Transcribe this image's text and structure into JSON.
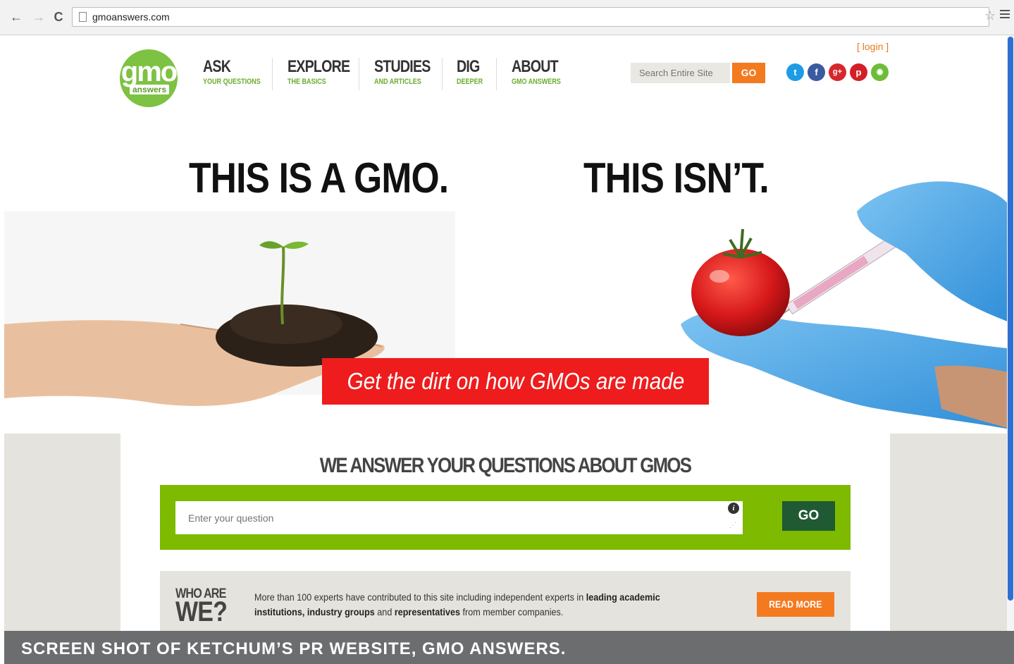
{
  "browser": {
    "url": "gmoanswers.com",
    "back_icon": "←",
    "forward_icon": "→",
    "reload_icon": "C",
    "star_icon": "☆"
  },
  "header": {
    "logo_top": "gmo",
    "logo_bottom": "answers",
    "login": "[ login ]",
    "search_placeholder": "Search Entire Site",
    "search_go": "GO",
    "nav": [
      {
        "big": "ASK",
        "small": "YOUR QUESTIONS"
      },
      {
        "big": "EXPLORE",
        "small": "THE BASICS"
      },
      {
        "big": "STUDIES",
        "small": "AND ARTICLES"
      },
      {
        "big": "DIG",
        "small": "DEEPER"
      },
      {
        "big": "ABOUT",
        "small": "GMO ANSWERS"
      }
    ],
    "social": [
      {
        "name": "twitter-icon",
        "glyph": "t",
        "color": "#1e9be6"
      },
      {
        "name": "facebook-icon",
        "glyph": "f",
        "color": "#3b5ba0"
      },
      {
        "name": "google-plus-icon",
        "glyph": "g+",
        "color": "#d7262b"
      },
      {
        "name": "pinterest-icon",
        "glyph": "p",
        "color": "#d31f26"
      },
      {
        "name": "rss-icon",
        "glyph": "◉",
        "color": "#6dbd3a"
      }
    ]
  },
  "hero": {
    "left_title": "THIS IS A GMO.",
    "right_title": "THIS ISN’T.",
    "cta": "Get the dirt on how GMOs are made"
  },
  "questions": {
    "heading": "WE ANSWER YOUR QUESTIONS ABOUT GMOS",
    "placeholder": "Enter your question",
    "info_glyph": "i",
    "go": "GO"
  },
  "who": {
    "line1": "WHO ARE",
    "line2": "WE?",
    "text_pre": "More than 100 experts have contributed to this site including independent experts in ",
    "text_bold1": "leading academic institutions, industry groups",
    "text_mid": " and ",
    "text_bold2": "representatives",
    "text_post": " from member companies.",
    "read_more": "READ MORE"
  },
  "caption": "SCREEN SHOT OF KETCHUM’S PR WEBSITE, GMO ANSWERS.",
  "colors": {
    "brand_green": "#7dc242",
    "orange": "#f47a20",
    "red": "#ee1c1c",
    "dark_green": "#1f5a33"
  }
}
